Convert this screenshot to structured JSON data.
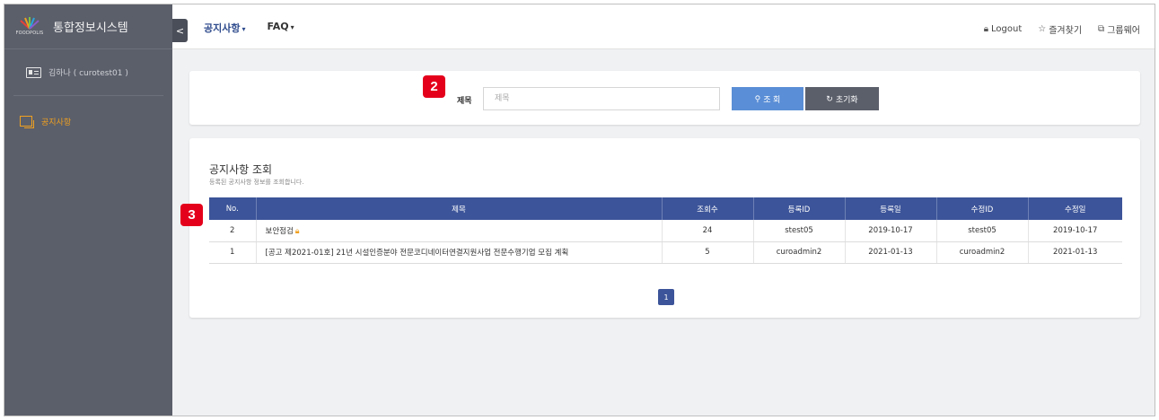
{
  "brand": {
    "title": "통합정보시스템",
    "logo_text": "FOODPOLIS"
  },
  "user": {
    "name": "김하나 ( curotest01 )"
  },
  "sidebar": {
    "items": [
      {
        "label": "공지사항"
      }
    ]
  },
  "topbar": {
    "collapse": "<",
    "menu": [
      {
        "label": "공지사항"
      },
      {
        "label": "FAQ"
      }
    ],
    "links": {
      "logout": "Logout",
      "favorites": "즐겨찾기",
      "groupware": "그룹웨어"
    }
  },
  "search": {
    "label": "제목",
    "placeholder": "제목",
    "search_btn": "조 회",
    "reset_btn": "초기화"
  },
  "badges": {
    "two": "2",
    "three": "3"
  },
  "result": {
    "title": "공지사항 조회",
    "desc": "등록된 공지사항 정보를 조회합니다.",
    "columns": [
      "No.",
      "제목",
      "조회수",
      "등록ID",
      "등록일",
      "수정ID",
      "수정일"
    ],
    "rows": [
      {
        "no": "2",
        "title": "보안점검",
        "views": "24",
        "reg_id": "stest05",
        "reg_date": "2019-10-17",
        "mod_id": "stest05",
        "mod_date": "2019-10-17",
        "locked": true
      },
      {
        "no": "1",
        "title": "[공고 제2021-01호] 21년 시설인증분야 전문코디네이터연결지원사업 전문수행기업 모집 계획",
        "views": "5",
        "reg_id": "curoadmin2",
        "reg_date": "2021-01-13",
        "mod_id": "curoadmin2",
        "mod_date": "2021-01-13",
        "locked": false
      }
    ],
    "page": "1"
  },
  "colors": {
    "sidebar": "#5b5f6a",
    "header": "#3c5499",
    "accent": "#f0a020",
    "search_btn": "#5a8ed6",
    "badge": "#e4001b"
  }
}
